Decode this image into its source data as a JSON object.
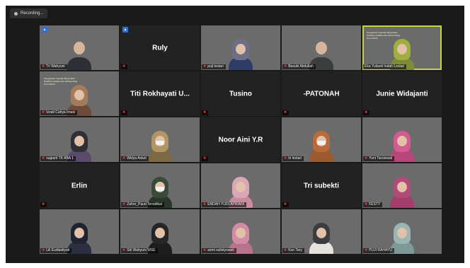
{
  "recording": {
    "label": "Recording..."
  },
  "participants": [
    {
      "name": "Tri Wahyuni",
      "type": "video",
      "host": true,
      "bg": "bg-wall",
      "hijab": "",
      "body": "#2e2e35",
      "muted": true
    },
    {
      "name": "Ruly",
      "type": "name",
      "host": true,
      "muted": true
    },
    {
      "name": "puji lestari",
      "type": "video",
      "bg": "bg-wall",
      "hijab": "#6d6f86",
      "body": "#2f3c66",
      "muted": true
    },
    {
      "name": "Basuki Abdullah",
      "type": "video",
      "bg": "bg-room",
      "hijab": "",
      "body": "#3a3e3c",
      "muted": true
    },
    {
      "name": "Eka Yulianti Indah Lestari",
      "type": "video",
      "bg": "bg-banner",
      "hijab": "#9fae3f",
      "body": "#7e8c39",
      "muted": false,
      "active": true,
      "banner": "Pengabdian Kepada Masyarakat Pelatihan Aplikasi dan Aktivasi Bagi Guru PAUD"
    },
    {
      "name": "Izzati Cahya Imani",
      "type": "video",
      "bg": "bg-banner",
      "hijab": "#a47c5c",
      "body": "#6b4c3a",
      "muted": true,
      "banner": "Pengabdian Kepada Masyarakat Pelatihan Aplikasi dan Aktivasi Bagi Guru PAUD"
    },
    {
      "name": "Titi Rokhayati U...",
      "type": "name",
      "muted": true
    },
    {
      "name": "Tusino",
      "type": "name",
      "muted": true
    },
    {
      "name": "-PATONAH",
      "type": "name",
      "muted": true
    },
    {
      "name": "Junie Widajanti",
      "type": "name",
      "muted": true
    },
    {
      "name": "sugiarti TK ABA 1",
      "type": "video",
      "bg": "bg-wall",
      "hijab": "#2d3136",
      "body": "#5a4b6e",
      "muted": true
    },
    {
      "name": "Widya Astuti",
      "type": "video",
      "bg": "bg-room",
      "hijab": "#b29564",
      "body": "#7d6a45",
      "muted": true,
      "mask": true
    },
    {
      "name": "Noor Aini Y.R",
      "type": "name",
      "muted": true
    },
    {
      "name": "tri lestari",
      "type": "video",
      "bg": "bg-green",
      "hijab": "#b86a3a",
      "body": "#9c5a2f",
      "muted": true,
      "mask": true
    },
    {
      "name": "Yuni Tarsiswati",
      "type": "video",
      "bg": "bg-banner",
      "hijab": "#d45b8f",
      "body": "#b7477a",
      "muted": true
    },
    {
      "name": "Erlin",
      "type": "name",
      "muted": true
    },
    {
      "name": "Zahro_Paud Tersidikal",
      "type": "video",
      "bg": "bg-dark",
      "hijab": "#3a4a3a",
      "body": "#2a362a",
      "muted": true,
      "mask": true
    },
    {
      "name": "ENDAH YUDI APRIANI",
      "type": "video",
      "bg": "bg-pink",
      "hijab": "#d9a7b7",
      "body": "#c88c9e",
      "muted": true
    },
    {
      "name": "Tri subekti",
      "type": "name",
      "muted": true
    },
    {
      "name": "FESTY",
      "type": "video",
      "bg": "bg-wall",
      "hijab": "#b24a7a",
      "body": "#a33d6b",
      "muted": true
    },
    {
      "name": "Lili Eudiastiyati",
      "type": "video",
      "bg": "bg-sky",
      "hijab": "#1f2430",
      "body": "#2a3040",
      "muted": true
    },
    {
      "name": "Siti Wahyuni WSE",
      "type": "video",
      "bg": "bg-wall2",
      "hijab": "#262626",
      "body": "#1d1d1d",
      "muted": true
    },
    {
      "name": "asmi sulistyowati",
      "type": "video",
      "bg": "bg-wall2",
      "hijab": "#d18ba3",
      "body": "#b8738c",
      "muted": true
    },
    {
      "name": "Kun Tary",
      "type": "video",
      "bg": "bg-wall",
      "hijab": "#3b3b40",
      "body": "#e6e2dc",
      "muted": true
    },
    {
      "name": "PUJI RAHAYU",
      "type": "video",
      "bg": "bg-green",
      "hijab": "#9ab5b3",
      "body": "#7d9a98",
      "muted": true
    }
  ]
}
